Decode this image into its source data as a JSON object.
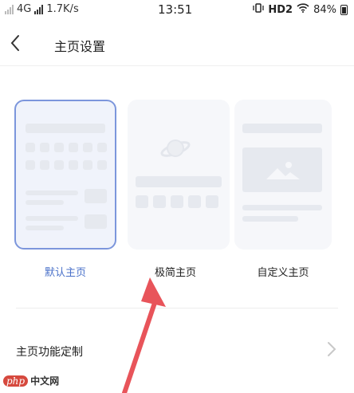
{
  "status": {
    "net_type": "4G",
    "net_speed": "1.7K/s",
    "time": "13:51",
    "hd_label": "HD2",
    "battery": "84%"
  },
  "header": {
    "title": "主页设置"
  },
  "options": [
    {
      "label": "默认主页",
      "selected": true
    },
    {
      "label": "极简主页",
      "selected": false
    },
    {
      "label": "自定义主页",
      "selected": false
    }
  ],
  "settings_row": {
    "label": "主页功能定制"
  },
  "watermark": {
    "brand": "php",
    "text": "中文网"
  },
  "colors": {
    "accent": "#4a71c9",
    "arrow": "#e8545a"
  }
}
